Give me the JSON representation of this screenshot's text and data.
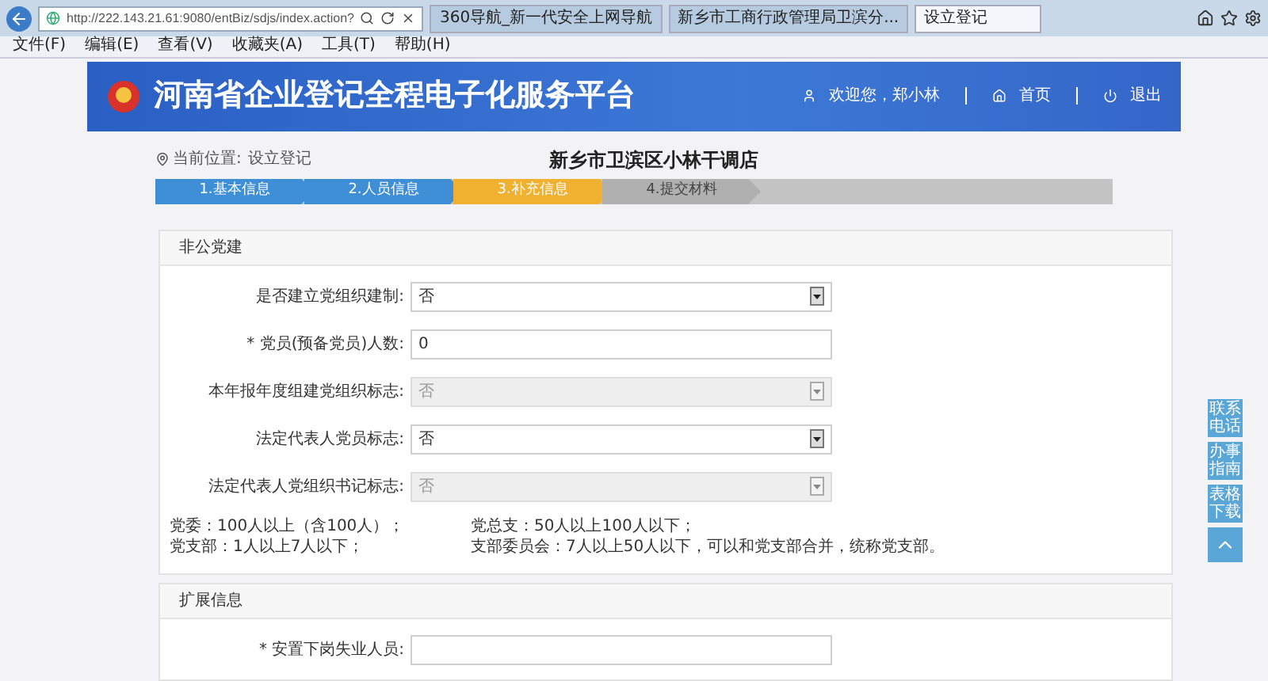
{
  "browser": {
    "address": "http://222.143.21.61:9080/entBiz/sdjs/index.action?",
    "tabs": [
      {
        "label": "360导航_新一代安全上网导航",
        "selected": false
      },
      {
        "label": "新乡市工商行政管理局卫滨分...",
        "selected": false
      },
      {
        "label": "设立登记",
        "selected": true
      }
    ],
    "menu": [
      "文件(F)",
      "编辑(E)",
      "查看(V)",
      "收藏夹(A)",
      "工具(T)",
      "帮助(H)"
    ]
  },
  "header": {
    "title": "河南省企业登记全程电子化服务平台",
    "user": "欢迎您，郑小林",
    "links": [
      "首页",
      "退出"
    ]
  },
  "breadcrumb": {
    "label": "当前位置:",
    "value": "设立登记"
  },
  "company": "新乡市卫滨区小林干调店",
  "steps": [
    {
      "label": "1.基本信息",
      "done": true,
      "selected": false
    },
    {
      "label": "2.人员信息",
      "done": true,
      "selected": false
    },
    {
      "label": "3.补充信息",
      "done": false,
      "selected": true
    },
    {
      "label": "4.提交材料",
      "done": false,
      "selected": false
    }
  ],
  "sections": [
    {
      "title": "非公党建",
      "fields": [
        {
          "label": "是否建立党组织建制:",
          "kind": "select",
          "value": "否",
          "disabled": false
        },
        {
          "label": "* 党员(预备党员)人数:",
          "kind": "text",
          "value": "0"
        },
        {
          "label": "本年报年度组建党组织标志:",
          "kind": "select",
          "value": "否",
          "disabled": true
        },
        {
          "label": "法定代表人党员标志:",
          "kind": "select",
          "value": "否",
          "disabled": false
        },
        {
          "label": "法定代表人党组织书记标志:",
          "kind": "select",
          "value": "否",
          "disabled": true
        }
      ],
      "notes": [
        [
          "党委：100人以上（含100人）；",
          "党总支：50人以上100人以下；"
        ],
        [
          "党支部：1人以上7人以下；",
          "支部委员会：7人以上50人以下，可以和党支部合并，统称党支部。"
        ]
      ]
    },
    {
      "title": "扩展信息",
      "fields": [
        {
          "label": "* 安置下岗失业人员:",
          "kind": "text"
        }
      ]
    }
  ],
  "side_buttons": [
    "联系电话",
    "办事指南",
    "表格下载"
  ]
}
